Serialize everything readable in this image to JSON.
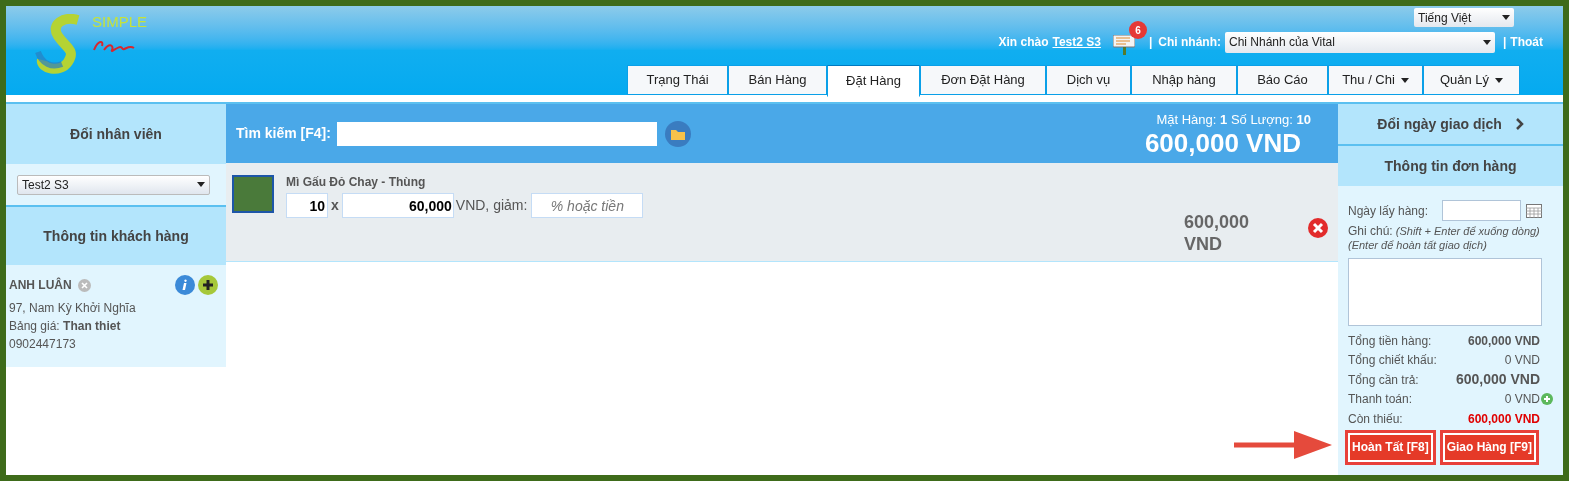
{
  "header": {
    "logo_text": "SIMPLE",
    "language": "Tiếng Việt",
    "greeting": "Xin chào",
    "user": "Test2 S3",
    "notification_count": "6",
    "separator": "|",
    "branch_label": "Chi nhánh:",
    "branch": "Chi Nhánh của Vital",
    "logout_separator": "|",
    "logout": "Thoát"
  },
  "tabs": [
    {
      "label": "Trạng Thái",
      "selected": false,
      "has_menu": false
    },
    {
      "label": "Bán Hàng",
      "selected": false,
      "has_menu": false
    },
    {
      "label": "Đặt Hàng",
      "selected": true,
      "has_menu": false
    },
    {
      "label": "Đơn Đặt Hàng",
      "selected": false,
      "has_menu": false
    },
    {
      "label": "Dịch vụ",
      "selected": false,
      "has_menu": false
    },
    {
      "label": "Nhập hàng",
      "selected": false,
      "has_menu": false
    },
    {
      "label": "Báo Cáo",
      "selected": false,
      "has_menu": false
    },
    {
      "label": "Thu / Chi",
      "selected": false,
      "has_menu": true
    },
    {
      "label": "Quản Lý",
      "selected": false,
      "has_menu": true
    }
  ],
  "left": {
    "staff_title": "Đổi nhân viên",
    "staff": "Test2 S3",
    "customer_title": "Thông tin khách hàng",
    "customer": {
      "name": "ANH LUÂN",
      "address": "97, Nam Kỳ Khởi Nghĩa",
      "price_list_label": "Bảng giá:",
      "price_list": "Than thiet",
      "phone": "0902447173"
    }
  },
  "search": {
    "label": "Tìm kiếm [F4]:",
    "summary": "Mặt Hàng: **1** Số Lượng: **10**",
    "total": "600,000 VND"
  },
  "items": [
    {
      "name": "Mì Gấu Đỏ Chay - Thùng",
      "quantity": "10",
      "times": "x",
      "price": "60,000",
      "unit": "VND, giảm:",
      "discount_placeholder": "% hoặc tiền",
      "amount": "600,000 VND"
    }
  ],
  "right": {
    "change_date": "Đổi ngày giao dịch",
    "order_title": "Thông tin đơn hàng",
    "pickup_label": "Ngày lấy hàng:",
    "note_label": "Ghi chú:",
    "note_hint": "(Shift + Enter để xuống dòng) (Enter để hoàn tất giao dịch)",
    "totals": [
      {
        "label": "Tổng tiền hàng:",
        "value": "600,000 VND",
        "kind": "bold"
      },
      {
        "label": "Tổng chiết khấu:",
        "value": "0 VND",
        "kind": "plain"
      },
      {
        "label": "Tổng cần trả:",
        "value": "600,000 VND",
        "kind": "total"
      },
      {
        "label": "Thanh toán:",
        "value": "0 VND",
        "kind": "payment"
      },
      {
        "label": "Còn thiếu:",
        "value": "600,000 VND",
        "kind": "due"
      }
    ],
    "buttons": [
      {
        "label": "Hoàn Tất [F8]",
        "highlighted": true
      },
      {
        "label": "Giao Hàng [F9]",
        "highlighted": true
      }
    ]
  }
}
